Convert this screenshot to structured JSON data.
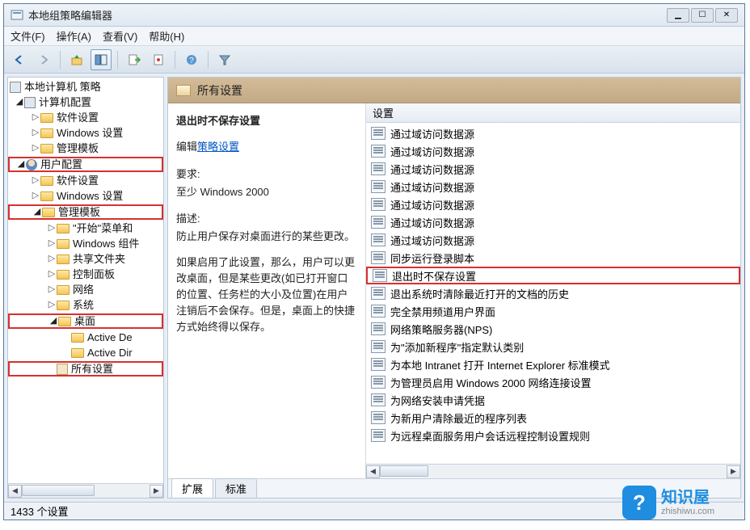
{
  "titlebar": {
    "title": "本地组策略编辑器"
  },
  "menu": {
    "file": "文件(F)",
    "action": "操作(A)",
    "view": "查看(V)",
    "help": "帮助(H)"
  },
  "tree": {
    "root": "本地计算机 策略",
    "computer": "计算机配置",
    "c_soft": "软件设置",
    "c_win": "Windows 设置",
    "c_admin": "管理模板",
    "user": "用户配置",
    "u_soft": "软件设置",
    "u_win": "Windows 设置",
    "u_admin": "管理模板",
    "t_start": "\"开始\"菜单和",
    "t_wincomp": "Windows 组件",
    "t_share": "共享文件夹",
    "t_ctrl": "控制面板",
    "t_net": "网络",
    "t_sys": "系统",
    "t_desktop": "桌面",
    "t_ad1": "Active De",
    "t_ad2": "Active Dir",
    "t_all": "所有设置"
  },
  "right": {
    "header": "所有设置",
    "desc_title": "退出时不保存设置",
    "desc_edit_label": "编辑",
    "desc_edit_link": "策略设置",
    "req_label": "要求:",
    "req_val": "至少 Windows 2000",
    "desc_label": "描述:",
    "desc_p1": "防止用户保存对桌面进行的某些更改。",
    "desc_p2": "如果启用了此设置，那么，用户可以更改桌面，但是某些更改(如已打开窗口的位置、任务栏的大小及位置)在用户注销后不会保存。但是，桌面上的快捷方式始终得以保存。",
    "col_setting": "设置",
    "items": [
      "通过域访问数据源",
      "通过域访问数据源",
      "通过域访问数据源",
      "通过域访问数据源",
      "通过域访问数据源",
      "通过域访问数据源",
      "通过域访问数据源",
      "同步运行登录脚本",
      "退出时不保存设置",
      "退出系统时清除最近打开的文档的历史",
      "完全禁用频道用户界面",
      "网络策略服务器(NPS)",
      "为\"添加新程序\"指定默认类别",
      "为本地 Intranet 打开 Internet Explorer 标准模式",
      "为管理员启用 Windows 2000 网络连接设置",
      "为网络安装申请凭据",
      "为新用户清除最近的程序列表",
      "为远程桌面服务用户会话远程控制设置规则"
    ],
    "sel_index": 8,
    "tab_ext": "扩展",
    "tab_std": "标准"
  },
  "status": {
    "count": "1433 个设置"
  },
  "watermark": {
    "cn": "知识屋",
    "en": "zhishiwu.com"
  }
}
